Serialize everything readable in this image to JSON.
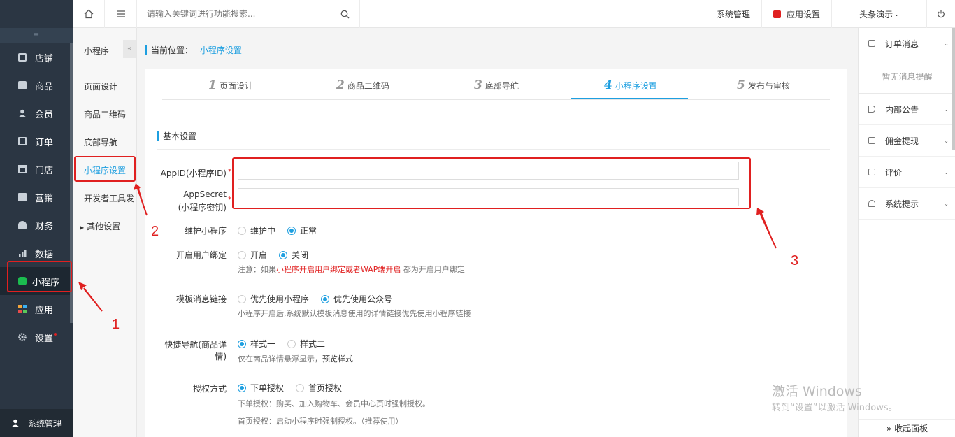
{
  "topbar": {
    "search_placeholder": "请输入关键词进行功能搜索...",
    "system_manage": "系统管理",
    "app_settings": "应用设置",
    "store_name": "头条演示",
    "colors": {
      "brand_red": "#e02020"
    }
  },
  "nav": {
    "collapse_glyph": "≡",
    "items": [
      {
        "label": "店铺",
        "icon": "store-icon"
      },
      {
        "label": "商品",
        "icon": "goods-icon"
      },
      {
        "label": "会员",
        "icon": "member-icon"
      },
      {
        "label": "订单",
        "icon": "order-icon"
      },
      {
        "label": "门店",
        "icon": "shop-icon"
      },
      {
        "label": "营销",
        "icon": "marketing-icon"
      },
      {
        "label": "财务",
        "icon": "finance-icon"
      },
      {
        "label": "数据",
        "icon": "data-icon"
      },
      {
        "label": "小程序",
        "icon": "miniprogram-icon",
        "active": true
      },
      {
        "label": "应用",
        "icon": "apps-icon"
      },
      {
        "label": "设置",
        "icon": "settings-icon"
      }
    ],
    "bottom_label": "系统管理"
  },
  "submenu": {
    "title": "小程序",
    "items": [
      "页面设计",
      "商品二维码",
      "底部导航",
      "小程序设置",
      "开发者工具发",
      "其他设置"
    ],
    "active_index": 3
  },
  "breadcrumb": {
    "prefix": "当前位置：",
    "current": "小程序设置"
  },
  "steps": [
    {
      "num": "1",
      "label": "页面设计"
    },
    {
      "num": "2",
      "label": "商品二维码"
    },
    {
      "num": "3",
      "label": "底部导航"
    },
    {
      "num": "4",
      "label": "小程序设置",
      "active": true
    },
    {
      "num": "5",
      "label": "发布与审核"
    }
  ],
  "form": {
    "section_title": "基本设置",
    "appid_label": "AppID(小程序ID)",
    "appsecret_label_1": "AppSecret",
    "appsecret_label_2": "(小程序密钥)",
    "required_mark": "*",
    "appid_value": "",
    "appsecret_value": "",
    "maintain_label": "维护小程序",
    "maintain_opt1": "维护中",
    "maintain_opt2": "正常",
    "bind_label": "开启用户绑定",
    "bind_opt1": "开启",
    "bind_opt2": "关闭",
    "bind_note_prefix": "注意：如果",
    "bind_note_red": "小程序开启用户绑定或者WAP端开启",
    "bind_note_suffix": " 都为开启用户绑定",
    "tpl_label": "模板消息链接",
    "tpl_opt1": "优先使用小程序",
    "tpl_opt2": "优先使用公众号",
    "tpl_note": "小程序开启后,系统默认模板消息使用的详情链接优先使用小程序链接",
    "quicknav_label_1": "快捷导航(商品详",
    "quicknav_label_2": "情)",
    "quicknav_opt1": "样式一",
    "quicknav_opt2": "样式二",
    "quicknav_note": "仅在商品详情悬浮显示，",
    "quicknav_link": "预览样式",
    "auth_label": "授权方式",
    "auth_opt1": "下单授权",
    "auth_opt2": "首页授权",
    "auth_note1": "下单授权：购买、加入购物车、会员中心页时强制授权。",
    "auth_note2": "首页授权：启动小程序时强制授权。（推荐使用）"
  },
  "annotations": {
    "a1": "1",
    "a2": "2",
    "a3": "3"
  },
  "right_panel": {
    "order_msg": "订单消息",
    "no_msg": "暂无消息提醒",
    "notice": "内部公告",
    "commission": "佣金提现",
    "review": "评价",
    "system_tips": "系统提示",
    "collapse": "» 收起面板"
  },
  "watermark": {
    "line1": "激活 Windows",
    "line2": "转到“设置”以激活 Windows。"
  }
}
